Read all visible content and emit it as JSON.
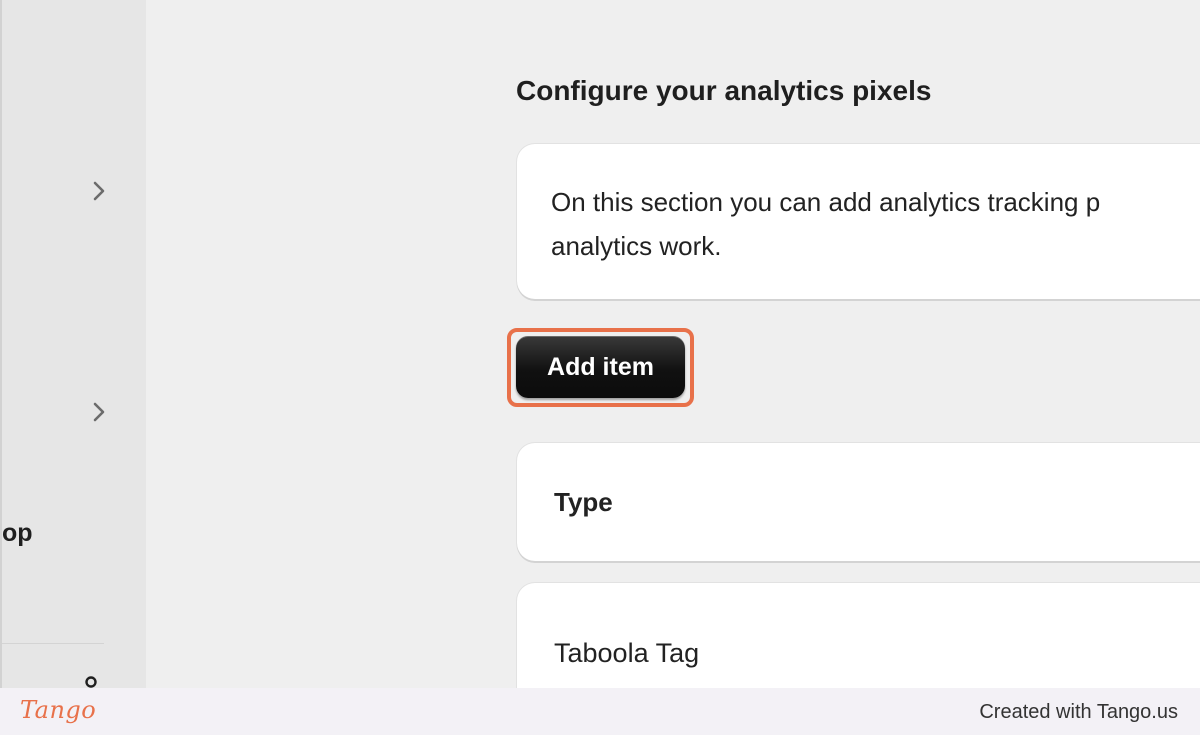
{
  "sidebar": {
    "chevron_icon": "chevron-right-icon",
    "cut_off_label": "op",
    "person_icon": "person-icon"
  },
  "main": {
    "title": "Configure your analytics pixels",
    "description_line1": "On this section you can add analytics tracking p",
    "description_line2": "analytics work.",
    "add_button_label": "Add item",
    "type_label": "Type",
    "tag_value": "Taboola Tag"
  },
  "highlight": {
    "color": "#e8714a"
  },
  "footer": {
    "logo_text": "Tango",
    "credit": "Created with Tango.us"
  }
}
